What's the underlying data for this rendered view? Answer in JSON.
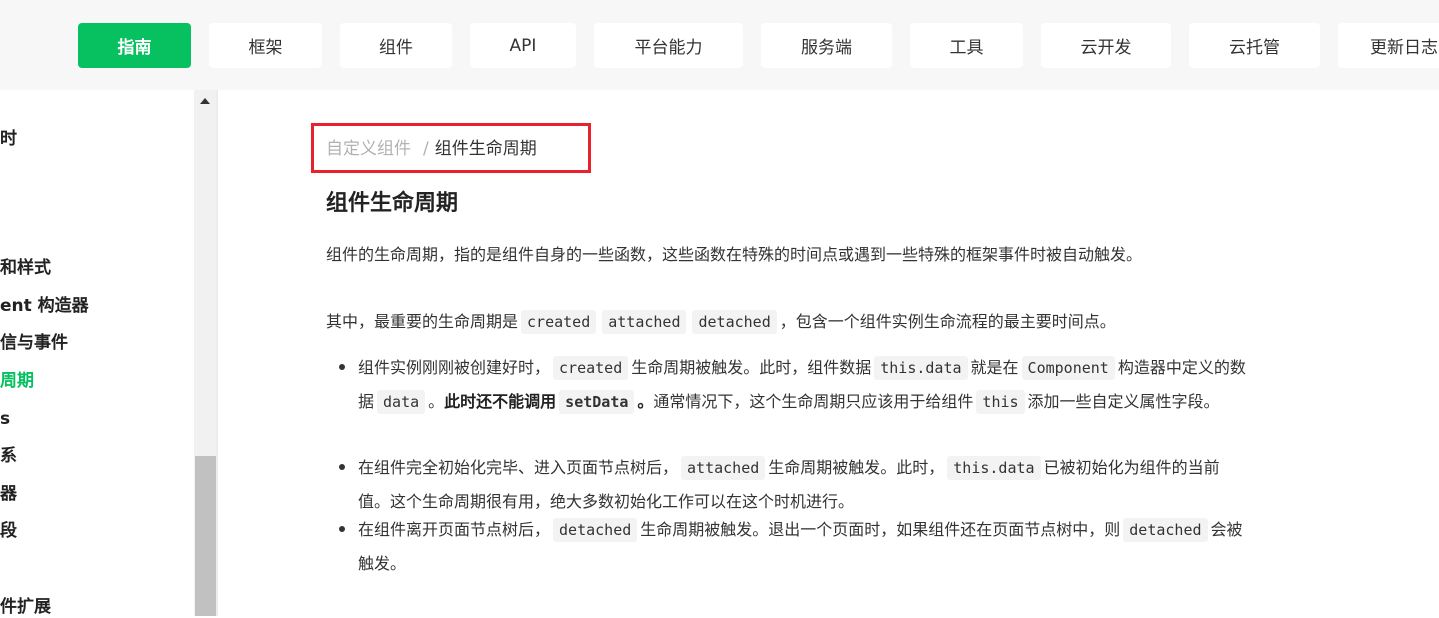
{
  "nav": {
    "items": [
      {
        "label": "指南",
        "active": true
      },
      {
        "label": "框架"
      },
      {
        "label": "组件"
      },
      {
        "label": "API"
      },
      {
        "label": "平台能力"
      },
      {
        "label": "服务端"
      },
      {
        "label": "工具"
      },
      {
        "label": "云开发"
      },
      {
        "label": "云托管"
      },
      {
        "label": "更新日志"
      }
    ]
  },
  "sidebar": {
    "items": [
      {
        "label": "时"
      },
      {
        "label": "和样式"
      },
      {
        "label": "ent 构造器"
      },
      {
        "label": "信与事件"
      },
      {
        "label": "周期",
        "active": true
      },
      {
        "label": "s"
      },
      {
        "label": "系"
      },
      {
        "label": "器"
      },
      {
        "label": "段"
      },
      {
        "label": "件扩展"
      }
    ]
  },
  "breadcrumb": {
    "parent": "自定义组件",
    "separator": "/",
    "current": "组件生命周期"
  },
  "article": {
    "title": "组件生命周期",
    "p1": "组件的生命周期，指的是组件自身的一些函数，这些函数在特殊的时间点或遇到一些特殊的框架事件时被自动触发。",
    "p2_before": "其中，最重要的生命周期是",
    "p2_code1": "created",
    "p2_code2": "attached",
    "p2_code3": "detached",
    "p2_after": "，包含一个组件实例生命流程的最主要时间点。",
    "b1_t1": "组件实例刚刚被创建好时，",
    "b1_c1": "created",
    "b1_t2": "生命周期被触发。此时，组件数据",
    "b1_c2": "this.data",
    "b1_t3": "就是在",
    "b1_c3": "Component",
    "b1_t4": "构造器中定义的数据",
    "b1_c4": "data",
    "b1_t5": "。",
    "b1_strong1": "此时还不能调用",
    "b1_strong_code": "setData",
    "b1_strong2": "。",
    "b1_t6": "通常情况下，这个生命周期只应该用于给组件",
    "b1_c5": "this",
    "b1_t7": "添加一些自定义属性字段。",
    "b2_t1": "在组件完全初始化完毕、进入页面节点树后，",
    "b2_c1": "attached",
    "b2_t2": "生命周期被触发。此时，",
    "b2_c2": "this.data",
    "b2_t3": "已被初始化为组件的当前值。这个生命周期很有用，绝大多数初始化工作可以在这个时机进行。",
    "b3_t1": "在组件离开页面节点树后，",
    "b3_c1": "detached",
    "b3_t2": "生命周期被触发。退出一个页面时，如果组件还在页面节点树中，则",
    "b3_c2": "detached",
    "b3_t3": "会被触发。"
  },
  "colors": {
    "accent": "#07c160",
    "highlight_box": "#e8222c",
    "topbar_bg": "#f7f7f7"
  }
}
